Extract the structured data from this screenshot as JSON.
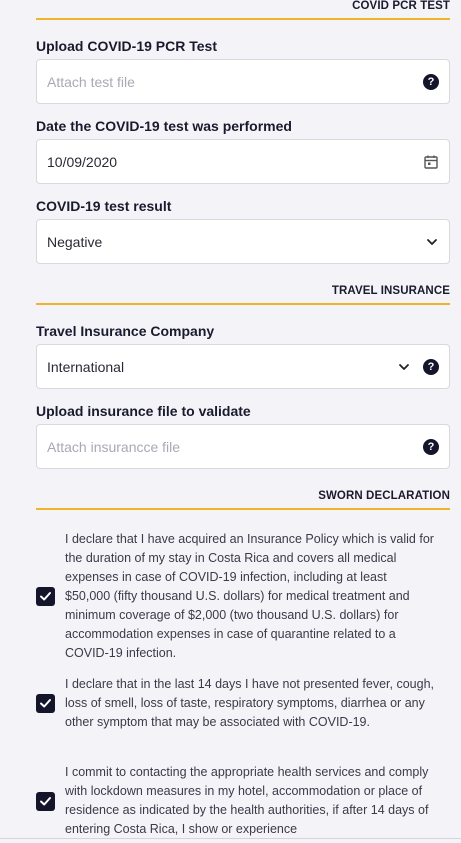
{
  "sections": {
    "covid": "COVID PCR TEST",
    "insurance": "TRAVEL INSURANCE",
    "sworn": "SWORN DECLARATION"
  },
  "fields": {
    "pcr_upload": {
      "label": "Upload COVID-19 PCR Test",
      "placeholder": "Attach test file"
    },
    "test_date": {
      "label": "Date the COVID-19 test was performed",
      "value": "10/09/2020"
    },
    "test_result": {
      "label": "COVID-19 test result",
      "value": "Negative"
    },
    "insurance_company": {
      "label": "Travel Insurance Company",
      "value": "International"
    },
    "insurance_upload": {
      "label": "Upload insurance file to validate",
      "placeholder": "Attach insurancce file"
    }
  },
  "declarations": [
    {
      "checked": true,
      "text": "I declare that I have acquired an Insurance Policy which is valid for the duration of my stay in Costa Rica and covers all medical expenses in case of COVID-19 infection, including at least $50,000 (fifty thousand U.S. dollars) for medical treatment and minimum coverage of $2,000 (two thousand U.S. dollars) for accommodation expenses in case of quarantine related to a COVID-19 infection."
    },
    {
      "checked": true,
      "text": "I declare that in the last 14 days I have not presented fever, cough, loss of smell, loss of taste, respiratory symptoms, diarrhea or any other symptom that may be associated with COVID-19."
    },
    {
      "checked": true,
      "text": "I commit to contacting the appropriate health services and comply with lockdown measures in my hotel, accommodation or place of residence as indicated by the health authorities, if after 14 days of entering Costa Rica, I show or experience"
    }
  ],
  "icons": {
    "help": "question-circle-icon",
    "calendar": "calendar-icon",
    "dropdown": "chevron-down-icon",
    "check": "checkmark-icon"
  },
  "colors": {
    "accent": "#f0b429",
    "dark": "#14142b"
  },
  "help_glyph": "?"
}
